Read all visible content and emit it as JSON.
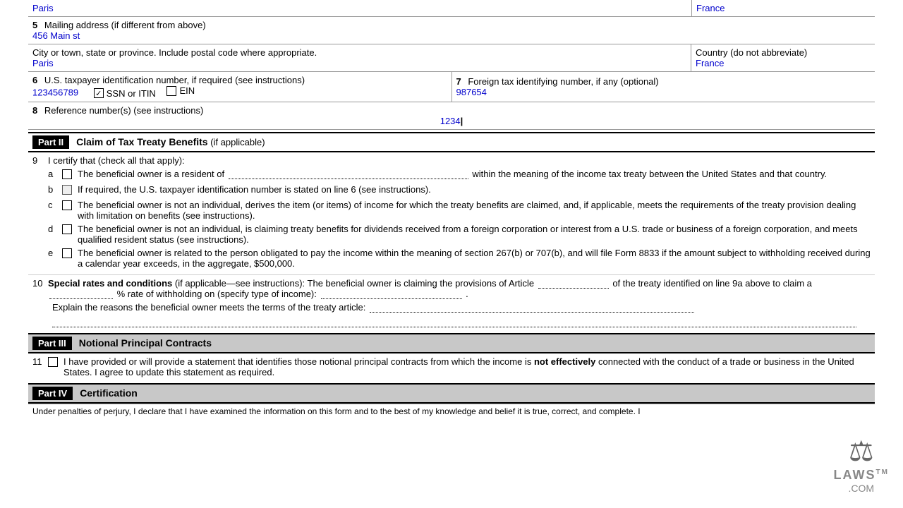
{
  "header": {
    "city_value": "Paris",
    "country_value": "France"
  },
  "row5": {
    "label": "5",
    "text": "Mailing address (if different from above)",
    "address_value": "456 Main st"
  },
  "row5b": {
    "city_label": "City or town, state or province. Include postal code where appropriate.",
    "city_value": "Paris",
    "country_label": "Country (do not abbreviate)",
    "country_value": "France"
  },
  "row6": {
    "label": "6",
    "text": "U.S. taxpayer identification number, if required (see instructions)",
    "value": "123456789",
    "ssn_label": "SSN or ITIN",
    "ein_label": "EIN",
    "ssn_checked": true,
    "ein_checked": false
  },
  "row7": {
    "label": "7",
    "text": "Foreign tax identifying number, if any (optional)",
    "value": "987654"
  },
  "row8": {
    "label": "8",
    "text": "Reference number(s) (see instructions)",
    "value": "1234"
  },
  "part2": {
    "label": "Part II",
    "title": "Claim of Tax Treaty Benefits",
    "subtitle": "(if applicable)"
  },
  "section9": {
    "label": "9",
    "text": "I certify that (check all that apply):",
    "items": [
      {
        "letter": "a",
        "text_before": "The beneficial owner is a resident of",
        "dotted": true,
        "text_after": "within the meaning of the income tax treaty between the United States and that country.",
        "checked": false
      },
      {
        "letter": "b",
        "text": "If required, the U.S. taxpayer identification number is stated on line 6 (see instructions).",
        "checked": false
      },
      {
        "letter": "c",
        "text": "The beneficial owner is not an individual, derives the item (or items) of income for which the treaty benefits are claimed, and, if applicable, meets the requirements of the treaty provision dealing with limitation on benefits (see instructions).",
        "checked": false
      },
      {
        "letter": "d",
        "text": "The beneficial owner is not an individual, is claiming treaty benefits for dividends received from a foreign corporation or interest from a U.S. trade or business of a foreign corporation, and meets qualified resident status (see instructions).",
        "checked": false
      },
      {
        "letter": "e",
        "text": "The beneficial owner is related to the person obligated to pay the income within the meaning of section 267(b) or 707(b), and will file Form 8833 if the amount subject to withholding received during a calendar year exceeds, in the aggregate, $500,000.",
        "checked": false
      }
    ]
  },
  "section10": {
    "label": "10",
    "text_bold": "Special rates and conditions",
    "text_rest": " (if applicable—see instructions): The beneficial owner is claiming the provisions of Article",
    "text2": "of the treaty identified on line 9a above to claim a",
    "text3": "% rate of withholding on (specify type of income):",
    "text4": ".",
    "text5": "Explain the reasons the beneficial owner meets the terms of the treaty article:"
  },
  "part3": {
    "label": "Part III",
    "title": "Notional Principal Contracts"
  },
  "section11": {
    "label": "11",
    "text": "I have provided or will provide a statement that identifies those notional principal contracts from which the income is not effectively connected with the conduct of a trade or business in the United States. I agree to update this statement as required.",
    "checked": false
  },
  "part4": {
    "label": "Part IV",
    "title": "Certification"
  },
  "footer": {
    "text": "Under penalties of perjury, I declare that I have examined the information on this form and to the best of my knowledge and belief it is true, correct, and complete. I"
  },
  "watermark": {
    "icon": "⚖",
    "brand": "LAWS",
    "tm": "TM",
    "domain": ".COM"
  }
}
